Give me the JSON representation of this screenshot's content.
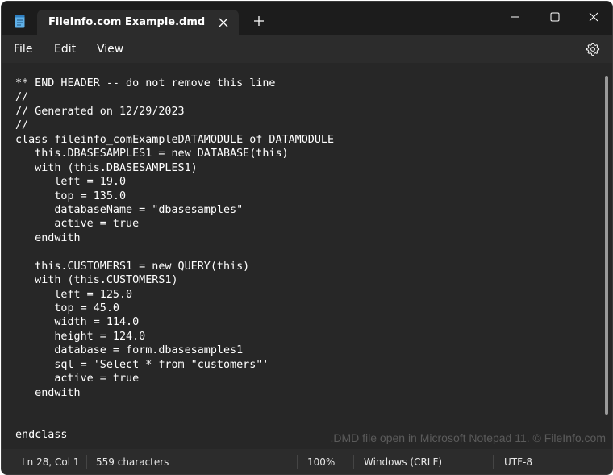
{
  "window": {
    "tab_title": "FileInfo.com Example.dmd"
  },
  "menu": {
    "file": "File",
    "edit": "Edit",
    "view": "View"
  },
  "editor": {
    "lines": [
      "** END HEADER -- do not remove this line",
      "//",
      "// Generated on 12/29/2023",
      "//",
      "class fileinfo_comExampleDATAMODULE of DATAMODULE",
      "   this.DBASESAMPLES1 = new DATABASE(this)",
      "   with (this.DBASESAMPLES1)",
      "      left = 19.0",
      "      top = 135.0",
      "      databaseName = \"dbasesamples\"",
      "      active = true",
      "   endwith",
      "",
      "   this.CUSTOMERS1 = new QUERY(this)",
      "   with (this.CUSTOMERS1)",
      "      left = 125.0",
      "      top = 45.0",
      "      width = 114.0",
      "      height = 124.0",
      "      database = form.dbasesamples1",
      "      sql = 'Select * from \"customers\"'",
      "      active = true",
      "   endwith",
      "",
      "",
      "endclass"
    ],
    "watermark": ".DMD file open in Microsoft Notepad 11. © FileInfo.com"
  },
  "status": {
    "position": "Ln 28, Col 1",
    "characters": "559 characters",
    "zoom": "100%",
    "line_ending": "Windows (CRLF)",
    "encoding": "UTF-8"
  },
  "icons": {
    "app": "notepad-icon",
    "tab_close": "close-icon",
    "new_tab": "plus-icon",
    "minimize": "minimize-icon",
    "maximize": "maximize-icon",
    "close": "close-icon",
    "settings": "gear-icon"
  },
  "colors": {
    "editor_bg": "#272727",
    "chrome_bg": "#2c2c2c",
    "titlebar_bg": "#1c1c1c",
    "text": "#ffffff",
    "app_icon": "#5fb0e8"
  }
}
